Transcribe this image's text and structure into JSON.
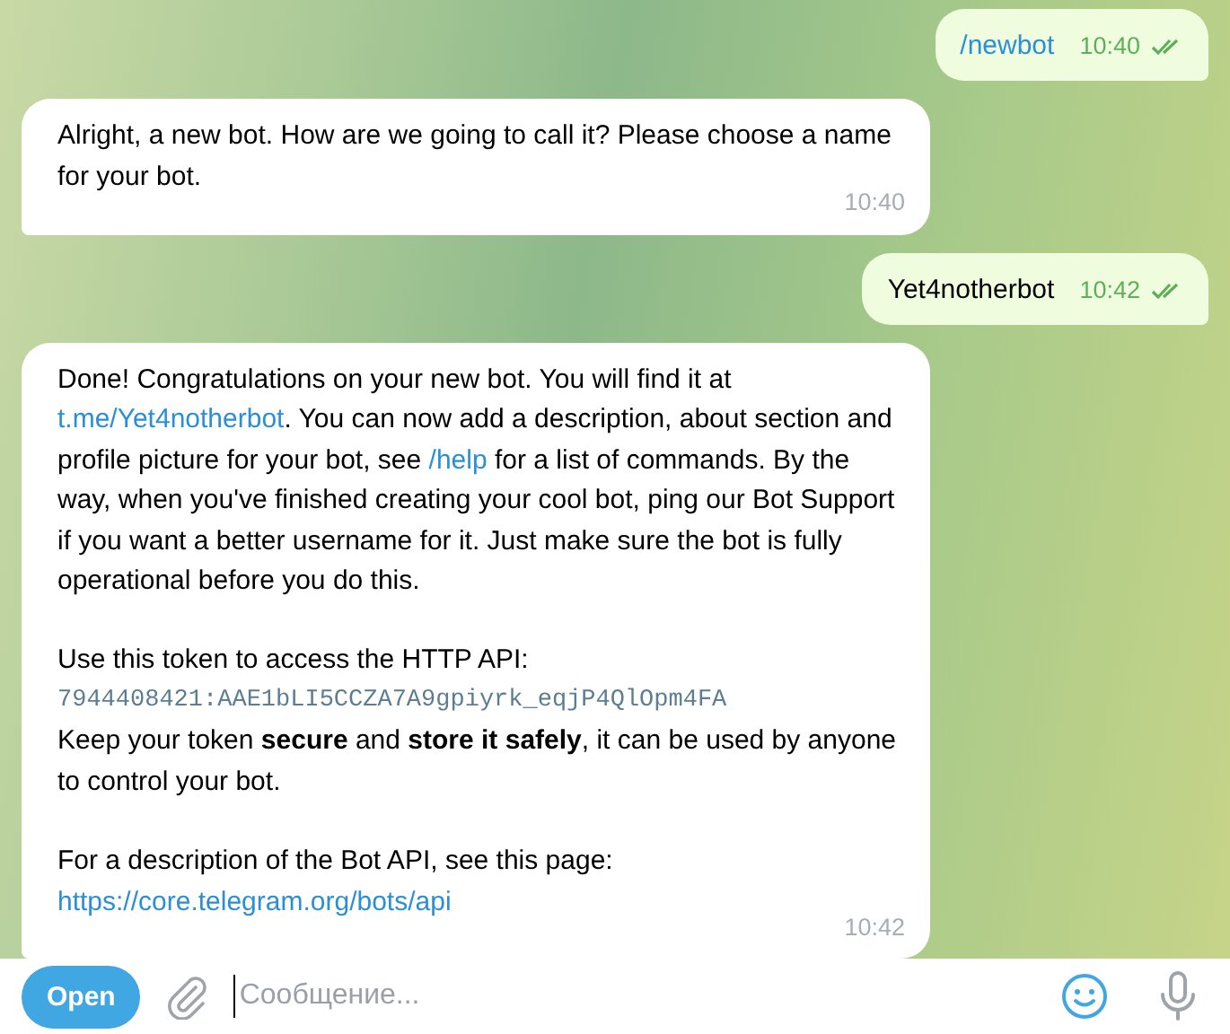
{
  "messages": [
    {
      "kind": "out",
      "paragraphs": [
        [
          [
            {
              "kind": "link",
              "text": "/newbot"
            }
          ]
        ]
      ],
      "time": "10:40",
      "read": true
    },
    {
      "kind": "in",
      "paragraphs": [
        [
          [
            {
              "kind": "text",
              "text": "Alright, a new bot. How are we going to call it? Please choose a name for your bot."
            }
          ]
        ]
      ],
      "time": "10:40"
    },
    {
      "kind": "out",
      "paragraphs": [
        [
          [
            {
              "kind": "text",
              "text": "Yet4notherbot"
            }
          ]
        ]
      ],
      "time": "10:42",
      "read": true
    },
    {
      "kind": "in",
      "paragraphs": [
        [
          [
            {
              "kind": "text",
              "text": "Done! Congratulations on your new bot. You will find it at "
            },
            {
              "kind": "link",
              "text": "t.me/Yet4notherbot"
            },
            {
              "kind": "text",
              "text": ". You can now add a description, about section and profile picture for your bot, see "
            },
            {
              "kind": "link",
              "text": "/help"
            },
            {
              "kind": "text",
              "text": " for a list of commands. By the way, when you've finished creating your cool bot, ping our Bot Support if you want a better username for it. Just make sure the bot is fully operational before you do this."
            }
          ]
        ],
        [
          [
            {
              "kind": "text",
              "text": "Use this token to access the HTTP API:"
            }
          ],
          [
            {
              "kind": "code",
              "text": "7944408421:AAE1bLI5CCZA7A9gpiyrk_eqjP4QlOpm4FA"
            }
          ],
          [
            {
              "kind": "text",
              "text": "Keep your token **secure** and **store it safely**, it can be used by anyone to control your bot."
            }
          ]
        ],
        [
          [
            {
              "kind": "text",
              "text": "For a description of the Bot API, see this page:"
            }
          ],
          [
            {
              "kind": "link",
              "text": "https://core.telegram.org/bots/api"
            }
          ]
        ]
      ],
      "time": "10:42"
    }
  ],
  "composer": {
    "button": "Open",
    "placeholder": "Сообщение..."
  }
}
